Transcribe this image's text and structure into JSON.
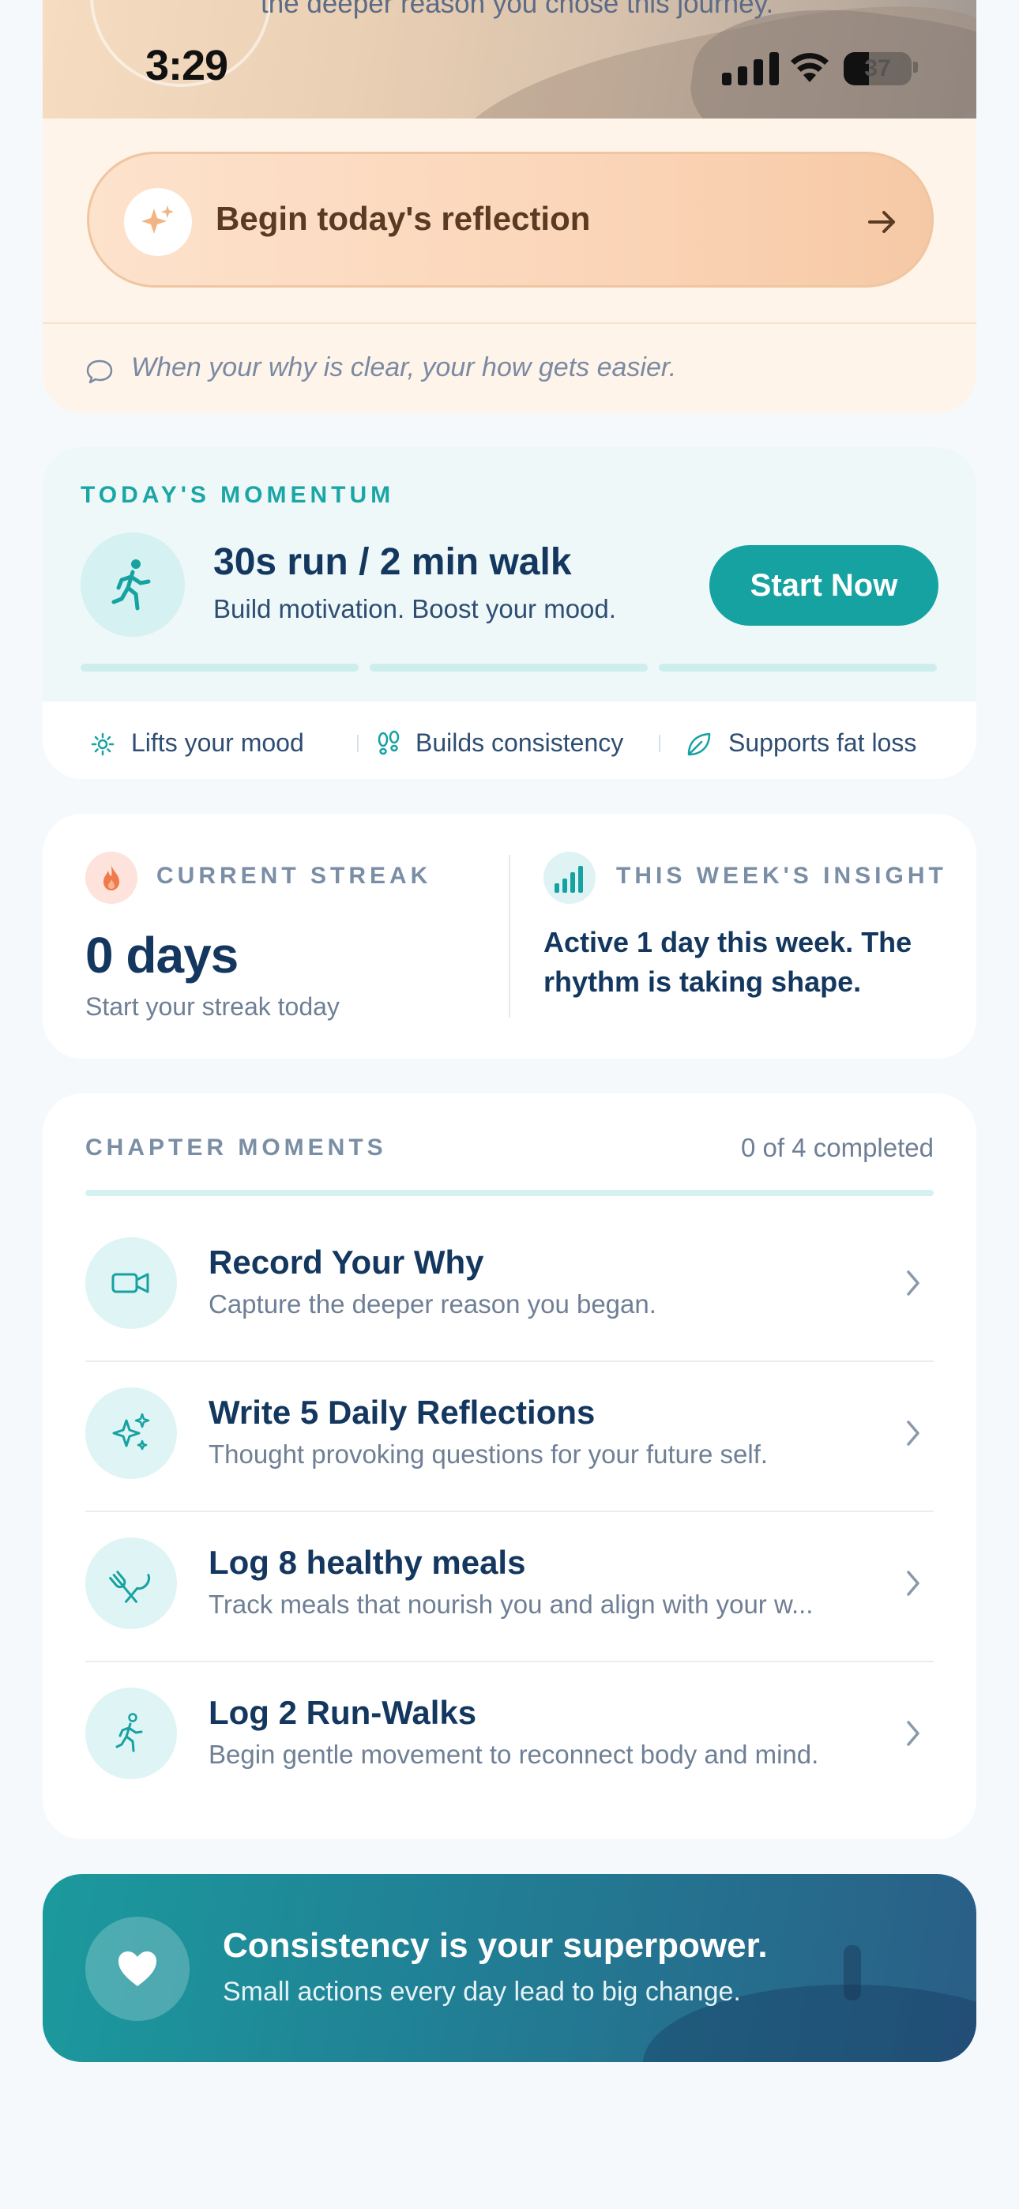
{
  "status_bar": {
    "time": "3:29",
    "battery": "37"
  },
  "hero": {
    "caption": "the deeper reason you chose this journey.",
    "reflection_button": "Begin today's reflection",
    "quote": "When your why is clear, your how gets easier."
  },
  "momentum": {
    "section_title": "TODAY'S MOMENTUM",
    "headline": "30s run / 2 min walk",
    "subtitle": "Build motivation. Boost your mood.",
    "start_button": "Start Now",
    "progress_segments": 3,
    "benefits": [
      "Lifts your mood",
      "Builds consistency",
      "Supports fat loss"
    ]
  },
  "streak": {
    "label": "CURRENT STREAK",
    "value": "0 days",
    "subtitle": "Start your streak today"
  },
  "insight": {
    "label": "THIS WEEK'S INSIGHT",
    "text": "Active 1 day this week. The rhythm is taking shape."
  },
  "chapter": {
    "title": "CHAPTER MOMENTS",
    "count": "0 of 4 completed",
    "completed_fraction": 0,
    "items": [
      {
        "icon": "video-camera-icon",
        "title": "Record Your Why",
        "description": "Capture the deeper reason you began."
      },
      {
        "icon": "sparkles-icon",
        "title": "Write 5 Daily Reflections",
        "description": "Thought provoking questions for your future self."
      },
      {
        "icon": "utensils-icon",
        "title": "Log 8 healthy meals",
        "description": "Track meals that nourish you and align with your w..."
      },
      {
        "icon": "runner-icon",
        "title": "Log 2 Run-Walks",
        "description": "Begin gentle movement to reconnect body and mind."
      }
    ]
  },
  "banner": {
    "title": "Consistency is your superpower.",
    "subtitle": "Small actions every day lead to big change."
  },
  "colors": {
    "accent_teal": "#17a2a2",
    "navy_text": "#13375e",
    "muted_text": "#6f7f95",
    "peach": "#fbd5b8",
    "flame": "#ef7a4a"
  }
}
